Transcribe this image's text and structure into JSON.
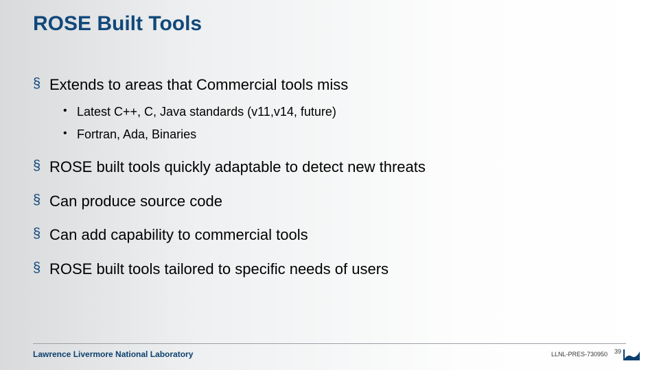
{
  "title": "ROSE Built Tools",
  "bullets": [
    {
      "text": "Extends to areas that Commercial tools miss",
      "sub": [
        "Latest C++, C, Java standards (v11,v14, future)",
        "Fortran, Ada, Binaries"
      ]
    },
    {
      "text": "ROSE built tools quickly adaptable to detect new threats",
      "sub": []
    },
    {
      "text": "Can produce source code",
      "sub": []
    },
    {
      "text": "Can add capability to commercial tools",
      "sub": []
    },
    {
      "text": "ROSE built tools tailored to specific needs of users",
      "sub": []
    }
  ],
  "footer": {
    "org": "Lawrence Livermore National Laboratory",
    "docid": "LLNL-PRES-730950",
    "page": "39"
  },
  "colors": {
    "accent": "#11487a"
  }
}
